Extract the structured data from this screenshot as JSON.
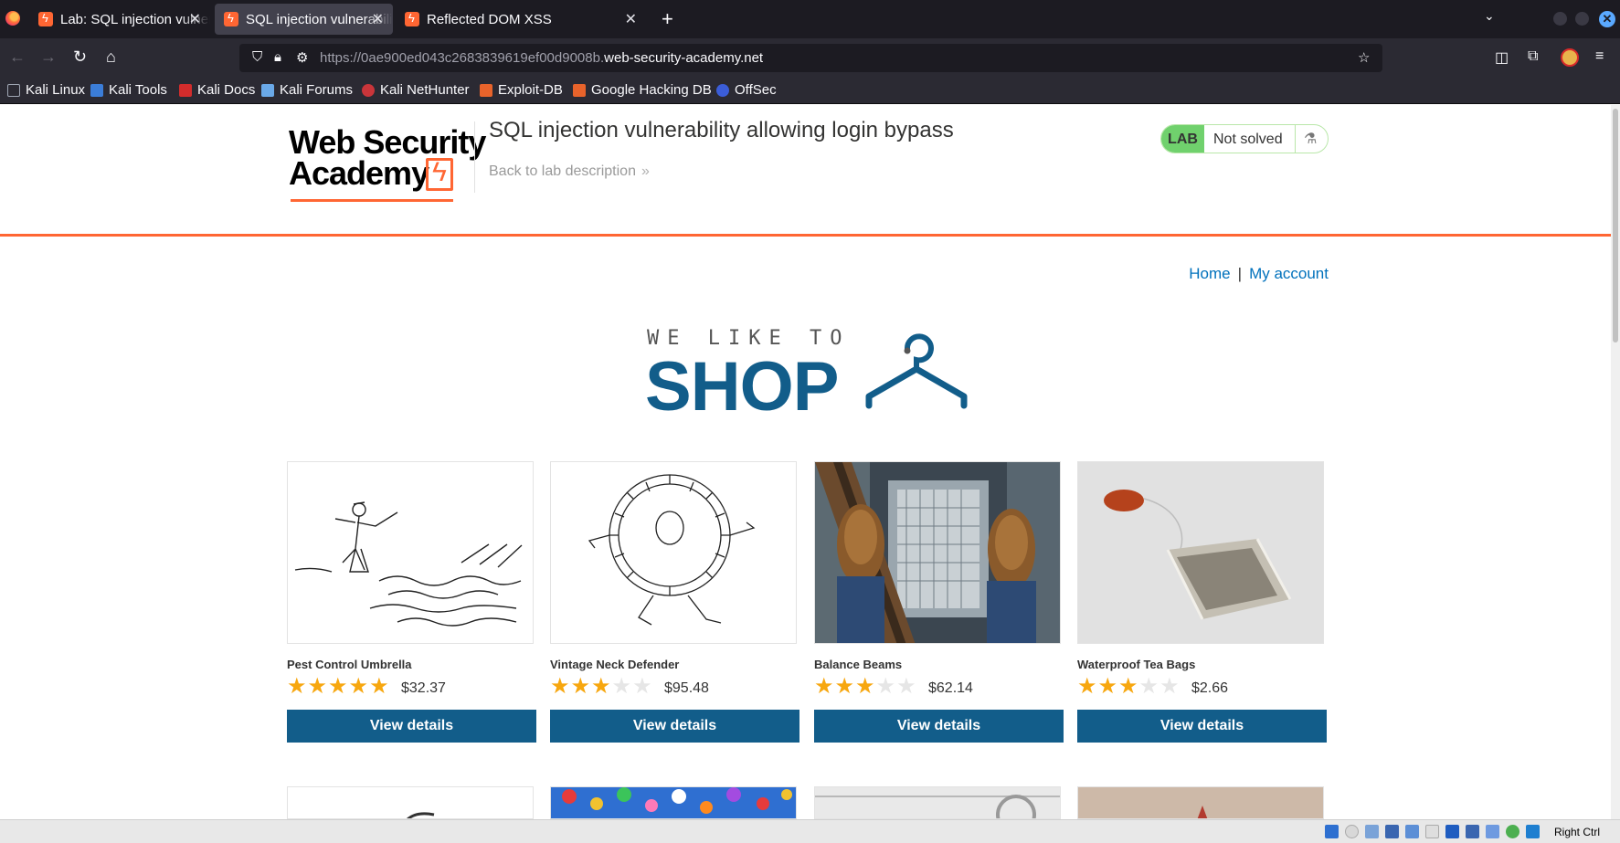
{
  "browser": {
    "tabs": [
      {
        "title": "Lab: SQL injection vulnerability allowing login bypass",
        "active": false
      },
      {
        "title": "SQL injection vulnerability allowing login bypass",
        "active": true
      },
      {
        "title": "Reflected DOM XSS",
        "active": false
      }
    ],
    "url_prefix": "https://0ae900ed043c2683839619ef00d9008b.",
    "url_host": "web-security-academy.net",
    "bookmarks": [
      "Kali Linux",
      "Kali Tools",
      "Kali Docs",
      "Kali Forums",
      "Kali NetHunter",
      "Exploit-DB",
      "Google Hacking DB",
      "OffSec"
    ]
  },
  "header": {
    "logo_line1": "Web Security",
    "logo_line2": "Academy",
    "lab_title": "SQL injection vulnerability allowing login bypass",
    "back_link": "Back to lab description",
    "badge_label": "LAB",
    "badge_status": "Not solved"
  },
  "nav": {
    "home": "Home",
    "separator": "|",
    "account": "My account"
  },
  "hero": {
    "tagline": "WE LIKE TO",
    "word": "SHOP"
  },
  "products": [
    {
      "name": "Pest Control Umbrella",
      "rating": 5,
      "price": "$32.37",
      "button": "View details"
    },
    {
      "name": "Vintage Neck Defender",
      "rating": 3,
      "price": "$95.48",
      "button": "View details"
    },
    {
      "name": "Balance Beams",
      "rating": 3,
      "price": "$62.14",
      "button": "View details"
    },
    {
      "name": "Waterproof Tea Bags",
      "rating": 3,
      "price": "$2.66",
      "button": "View details"
    }
  ],
  "statusbar": {
    "host_key": "Right Ctrl"
  },
  "colors": {
    "brand_orange": "#ff6633",
    "brand_blue": "#125d8a",
    "link_blue": "#0071bc",
    "star": "#f7a70f",
    "lab_green": "#70d16d"
  }
}
